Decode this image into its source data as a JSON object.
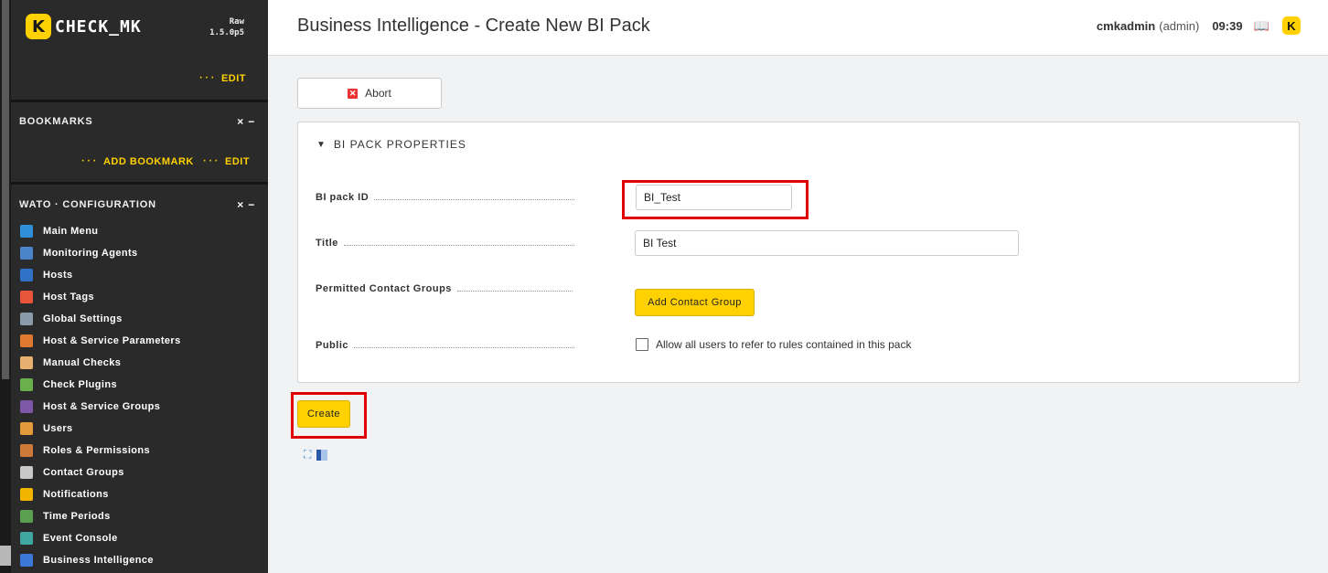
{
  "sidebar": {
    "brand": "CHECK_MK",
    "edition": "Raw",
    "version": "1.5.0p5",
    "top_edit": "EDIT",
    "bookmarks": {
      "title": "BOOKMARKS",
      "controls": "× −",
      "add_bookmark": "ADD BOOKMARK",
      "edit": "EDIT"
    },
    "wato": {
      "title": "WATO · CONFIGURATION",
      "controls": "× −",
      "items": [
        {
          "label": "Main Menu",
          "icon": "main-menu-icon",
          "color": "#2f8fd8"
        },
        {
          "label": "Monitoring Agents",
          "icon": "agents-icon",
          "color": "#4a84c9"
        },
        {
          "label": "Hosts",
          "icon": "hosts-icon",
          "color": "#2f72c7"
        },
        {
          "label": "Host Tags",
          "icon": "tag-icon",
          "color": "#e8553a"
        },
        {
          "label": "Global Settings",
          "icon": "gear-icon",
          "color": "#8a9aa8"
        },
        {
          "label": "Host & Service Parameters",
          "icon": "rules-icon",
          "color": "#e07a30"
        },
        {
          "label": "Manual Checks",
          "icon": "hand-icon",
          "color": "#e8b070"
        },
        {
          "label": "Check Plugins",
          "icon": "plugin-icon",
          "color": "#6ab04c"
        },
        {
          "label": "Host & Service Groups",
          "icon": "groups-icon",
          "color": "#7e57a8"
        },
        {
          "label": "Users",
          "icon": "users-icon",
          "color": "#e39a3a"
        },
        {
          "label": "Roles & Permissions",
          "icon": "roles-icon",
          "color": "#d07a3a"
        },
        {
          "label": "Contact Groups",
          "icon": "contact-groups-icon",
          "color": "#c8c8c8"
        },
        {
          "label": "Notifications",
          "icon": "bell-icon",
          "color": "#f2b600"
        },
        {
          "label": "Time Periods",
          "icon": "clock-icon",
          "color": "#5aa050"
        },
        {
          "label": "Event Console",
          "icon": "event-console-icon",
          "color": "#3fa7a0"
        },
        {
          "label": "Business Intelligence",
          "icon": "bi-icon",
          "color": "#3b78d8"
        }
      ]
    }
  },
  "header": {
    "title": "Business Intelligence - Create New BI Pack",
    "user": "cmkadmin",
    "role": "(admin)",
    "time": "09:39"
  },
  "main": {
    "abort_label": "Abort",
    "section_title": "BI PACK PROPERTIES",
    "fields": {
      "pack_id": {
        "label": "BI pack ID",
        "value": "BI_Test"
      },
      "title": {
        "label": "Title",
        "value": "BI Test"
      },
      "contact_groups": {
        "label": "Permitted Contact Groups",
        "button": "Add Contact Group"
      },
      "public": {
        "label": "Public",
        "checkbox_label": "Allow all users to refer to rules contained in this pack",
        "checked": false
      }
    },
    "create_label": "Create"
  },
  "colors": {
    "accent": "#ffd100",
    "sidebar_bg": "#2a2a2a",
    "highlight": "#e00000"
  }
}
